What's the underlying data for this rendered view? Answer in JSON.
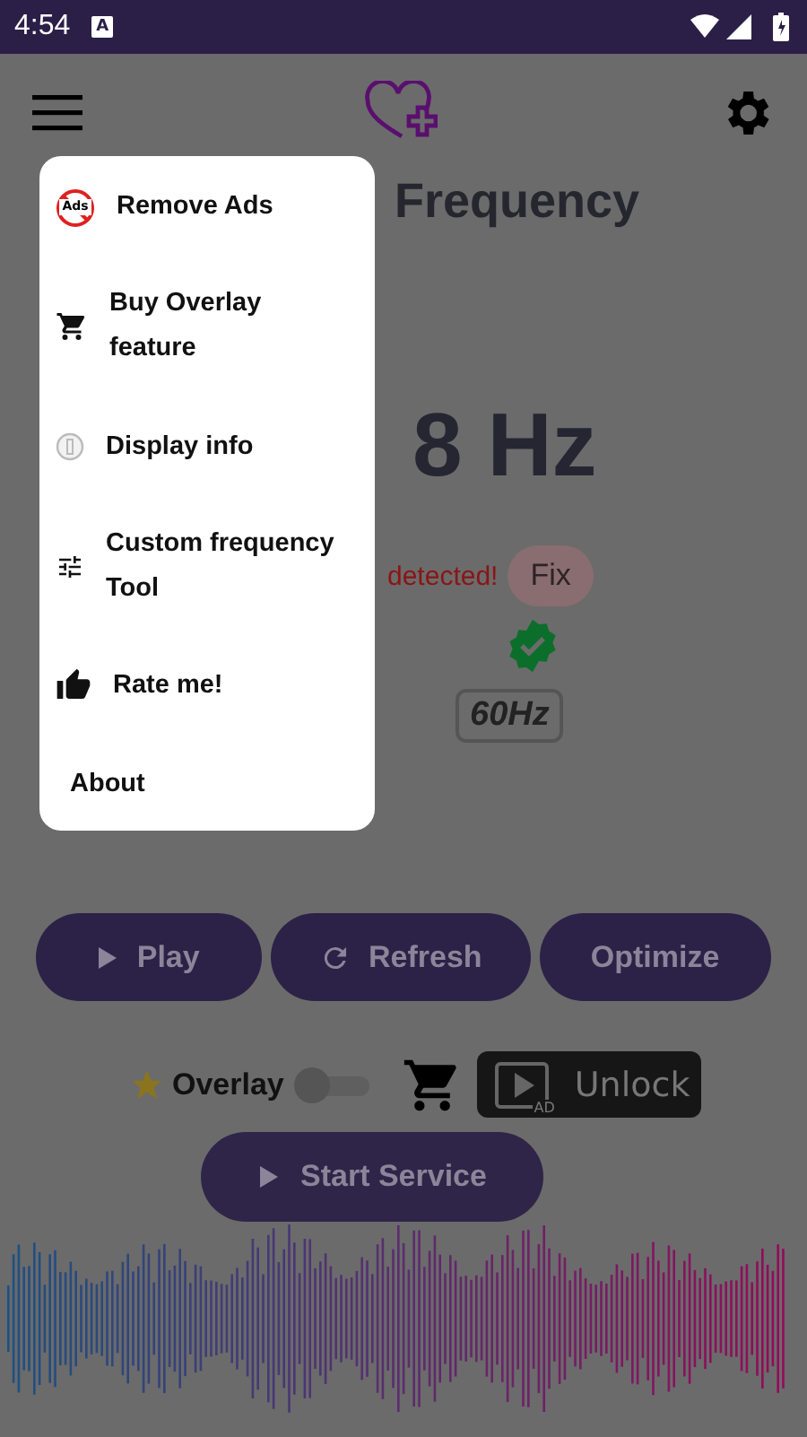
{
  "status_bar": {
    "time": "4:54",
    "app_icon_text": "A"
  },
  "title": "Frequency",
  "frequency": "8 Hz",
  "warning": {
    "text": "detected!",
    "fix_label": "Fix"
  },
  "hz_badge": "60Hz",
  "buttons": [
    {
      "label": "Play",
      "kind": "play"
    },
    {
      "label": "Refresh",
      "kind": "refresh"
    },
    {
      "label": "Optimize",
      "kind": "plain"
    }
  ],
  "overlay": {
    "label": "Overlay",
    "on": false
  },
  "unlock": {
    "label": "Unlock",
    "ad_text": "AD"
  },
  "start_button": {
    "label": "Start Service"
  },
  "menu": {
    "items": [
      {
        "label": "Remove Ads",
        "kind": "no-ads",
        "icon_text": "Ads"
      },
      {
        "label": "Buy Overlay feature",
        "kind": "cart"
      },
      {
        "label": "Display info",
        "kind": "info"
      },
      {
        "label": "Custom frequency Tool",
        "kind": "sliders"
      },
      {
        "label": "Rate me!",
        "kind": "thumb"
      },
      {
        "label": "About",
        "kind": "plain"
      }
    ]
  }
}
